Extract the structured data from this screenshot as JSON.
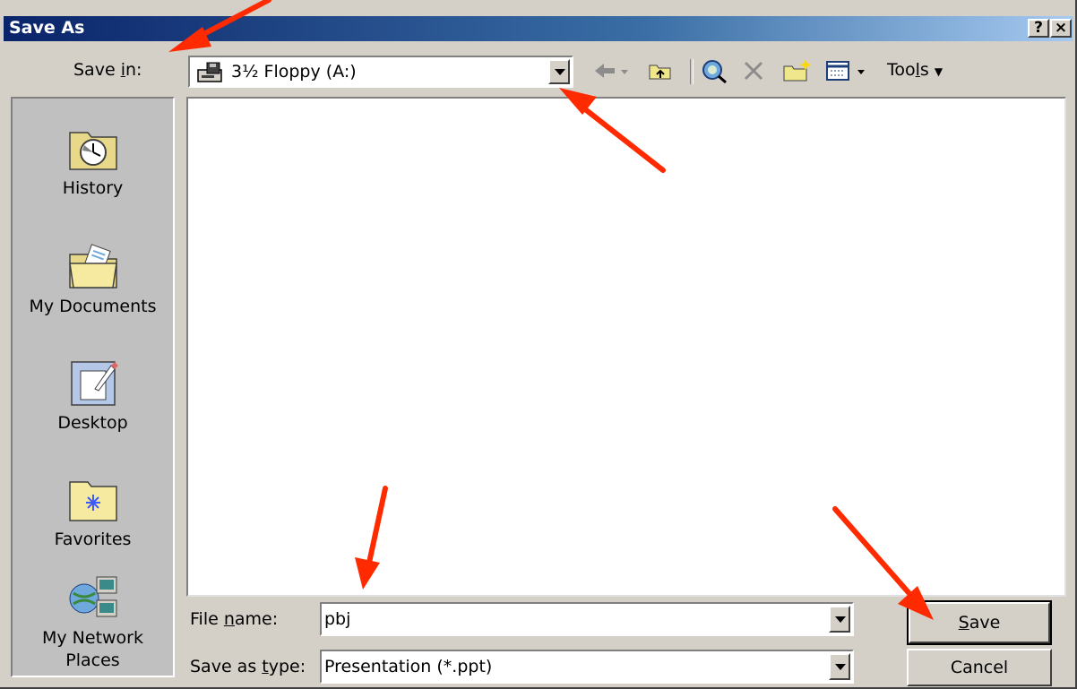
{
  "window": {
    "title": "Save As",
    "help_btn": "?",
    "close_btn": "×"
  },
  "save_in": {
    "label_pre": "Save ",
    "label_key": "i",
    "label_post": "n:",
    "value": "3½ Floppy (A:)",
    "icon": "floppy-drive-icon"
  },
  "toolbar": {
    "items": [
      "back-icon",
      "up-one-level-icon",
      "search-web-icon",
      "delete-icon",
      "new-folder-icon",
      "views-icon"
    ],
    "tools_pre": "Too",
    "tools_key": "l",
    "tools_post": "s"
  },
  "places": [
    {
      "label": "History",
      "icon": "history-icon"
    },
    {
      "label": "My Documents",
      "icon": "my-documents-icon"
    },
    {
      "label": "Desktop",
      "icon": "desktop-icon"
    },
    {
      "label": "Favorites",
      "icon": "favorites-icon"
    },
    {
      "label_line1": "My Network",
      "label_line2": "Places",
      "icon": "network-places-icon"
    }
  ],
  "file_name": {
    "label_pre": "File ",
    "label_key": "n",
    "label_post": "ame:",
    "value": "pbj"
  },
  "save_type": {
    "label_pre": "Save as ",
    "label_key": "t",
    "label_post": "ype:",
    "value": "Presentation (*.ppt)"
  },
  "buttons": {
    "save_key": "S",
    "save_rest": "ave",
    "cancel": "Cancel"
  },
  "annotation_color": "#ff2a00"
}
